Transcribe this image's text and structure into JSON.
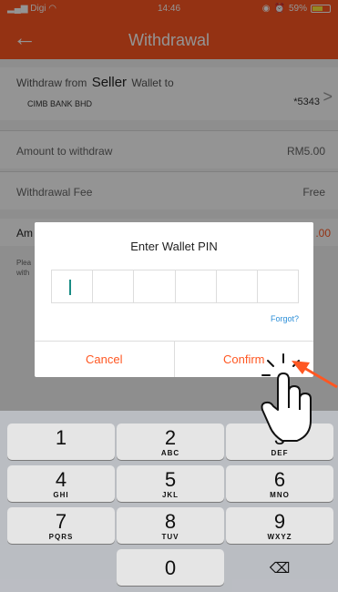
{
  "status_bar": {
    "carrier": "Digi",
    "time": "14:46",
    "battery": "59%"
  },
  "header": {
    "title": "Withdrawal",
    "back_icon": "back-arrow-icon"
  },
  "withdraw_card": {
    "from_prefix": "Withdraw from",
    "seller": "Seller",
    "to_suffix": "Wallet to",
    "bank": "CIMB BANK BHD",
    "account": "*5343",
    "chevron": ">"
  },
  "rows": [
    {
      "label": "Amount to withdraw",
      "value": "RM5.00"
    },
    {
      "label": "Withdrawal Fee",
      "value": "Free"
    }
  ],
  "row3": {
    "label": "Am",
    "value": ".00"
  },
  "note": "Plea with",
  "dialog": {
    "title": "Enter Wallet PIN",
    "forgot_label": "Forgot?",
    "cancel_label": "Cancel",
    "confirm_label": "Confirm"
  },
  "keyboard": {
    "keys": [
      {
        "digit": "1",
        "letters": ""
      },
      {
        "digit": "2",
        "letters": "ABC"
      },
      {
        "digit": "3",
        "letters": "DEF"
      },
      {
        "digit": "4",
        "letters": "GHI"
      },
      {
        "digit": "5",
        "letters": "JKL"
      },
      {
        "digit": "6",
        "letters": "MNO"
      },
      {
        "digit": "7",
        "letters": "PQRS"
      },
      {
        "digit": "8",
        "letters": "TUV"
      },
      {
        "digit": "9",
        "letters": "WXYZ"
      },
      {
        "digit": "0",
        "letters": ""
      }
    ],
    "delete_icon": "backspace-icon"
  },
  "colors": {
    "accent": "#ff5722",
    "link": "#2d8fd8",
    "cursor": "#1a8c85"
  }
}
